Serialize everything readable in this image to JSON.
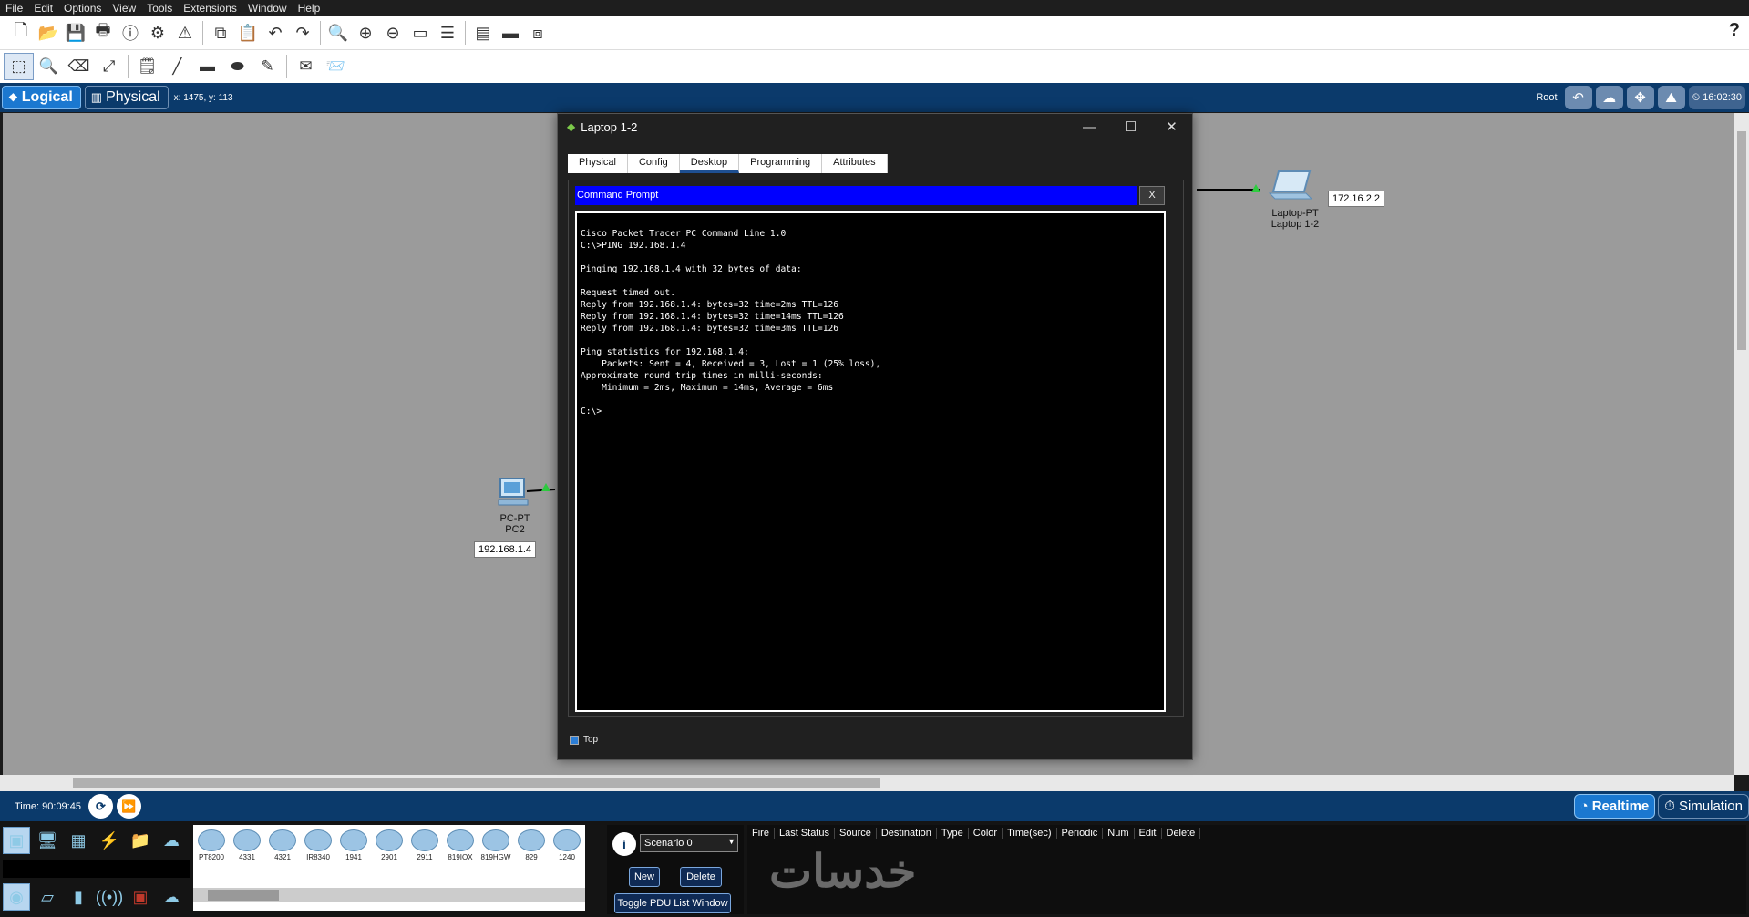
{
  "menu": [
    "File",
    "Edit",
    "Options",
    "View",
    "Tools",
    "Extensions",
    "Window",
    "Help"
  ],
  "help_label": "?",
  "workspace": {
    "logical_label": "Logical",
    "physical_label": "Physical",
    "coords": "x: 1475, y: 113",
    "root_label": "Root",
    "clock": "16:02:30"
  },
  "canvas": {
    "pc2": {
      "type_label": "PC-PT",
      "name_label": "PC2",
      "ip": "192.168.1.4"
    },
    "laptop": {
      "type_label": "Laptop-PT",
      "name_label": "Laptop 1-2",
      "ip": "172.16.2.2"
    }
  },
  "dialog": {
    "title": "Laptop 1-2",
    "tabs": [
      "Physical",
      "Config",
      "Desktop",
      "Programming",
      "Attributes"
    ],
    "active_tab": "Desktop",
    "cmd_header": "Command Prompt",
    "cmd_close": "X",
    "terminal_lines": [
      "Cisco Packet Tracer PC Command Line 1.0",
      "C:\\>PING 192.168.1.4",
      "",
      "Pinging 192.168.1.4 with 32 bytes of data:",
      "",
      "Request timed out.",
      "Reply from 192.168.1.4: bytes=32 time=2ms TTL=126",
      "Reply from 192.168.1.4: bytes=32 time=14ms TTL=126",
      "Reply from 192.168.1.4: bytes=32 time=3ms TTL=126",
      "",
      "Ping statistics for 192.168.1.4:",
      "    Packets: Sent = 4, Received = 3, Lost = 1 (25% loss),",
      "Approximate round trip times in milli-seconds:",
      "    Minimum = 2ms, Maximum = 14ms, Average = 6ms",
      "",
      "C:\\>"
    ],
    "top_label": "Top"
  },
  "timebar": {
    "time": "Time: 90:09:45",
    "realtime_label": "Realtime",
    "simulation_label": "Simulation"
  },
  "devices": [
    "PT8200",
    "4331",
    "4321",
    "IR8340",
    "1941",
    "2901",
    "2911",
    "819IOX",
    "819HGW",
    "829",
    "1240"
  ],
  "scenario": {
    "selected": "Scenario 0",
    "new_label": "New",
    "delete_label": "Delete",
    "toggle_label": "Toggle PDU List Window"
  },
  "pdu_columns": [
    "Fire",
    "Last Status",
    "Source",
    "Destination",
    "Type",
    "Color",
    "Time(sec)",
    "Periodic",
    "Num",
    "Edit",
    "Delete"
  ],
  "watermark": "خدسات",
  "colors": {
    "canvas_bg": "#9b9b9b",
    "workspace_bar": "#0b3a6b",
    "cmd_header": "#0000ff",
    "link_light": "#2ecc40"
  }
}
